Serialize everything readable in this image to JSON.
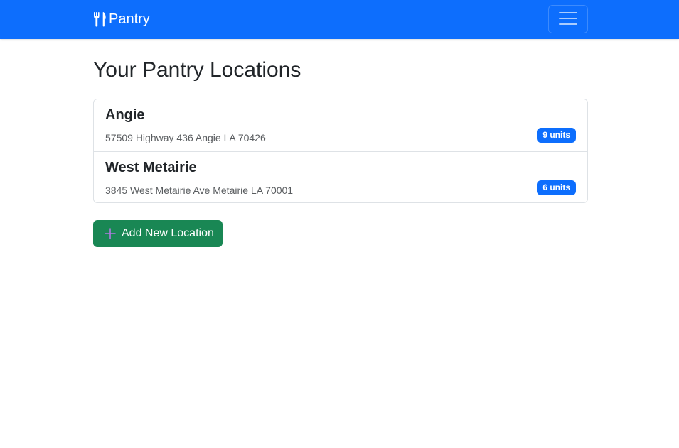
{
  "navbar": {
    "brand_icon": "fork-knife-icon",
    "brand": "Pantry",
    "toggler_icon": "hamburger-menu-icon",
    "color": "#0d6efd"
  },
  "page": {
    "title": "Your Pantry Locations"
  },
  "locations": [
    {
      "name": "Angie",
      "address": "57509 Highway 436 Angie LA 70426",
      "badge": "9 units"
    },
    {
      "name": "West Metairie",
      "address": "3845 West Metairie Ave Metairie LA 70001",
      "badge": "6 units"
    }
  ],
  "actions": {
    "add_icon": "plus-icon",
    "add_label": "Add New Location",
    "add_color": "#198754",
    "add_icon_color": "#b07be0"
  }
}
